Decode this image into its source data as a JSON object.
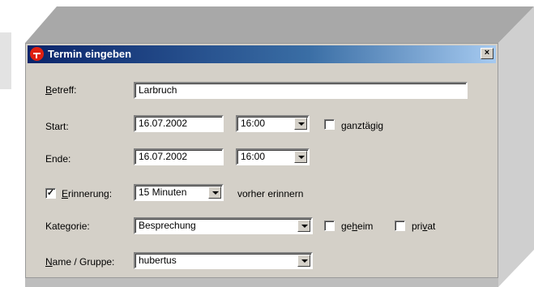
{
  "window": {
    "title": "Termin eingeben",
    "close_glyph": "×"
  },
  "form": {
    "betreff": {
      "label_u": "B",
      "label_rest": "etreff:",
      "value": "Larbruch"
    },
    "start": {
      "label": "Start:",
      "date": "16.07.2002",
      "time": "16:00",
      "allday_label": "ganztägig",
      "allday_checked": false
    },
    "ende": {
      "label": "Ende:",
      "date": "16.07.2002",
      "time": "16:00"
    },
    "erinnerung": {
      "label_u": "E",
      "label_rest": "rinnerung:",
      "checked": true,
      "value": "15 Minuten",
      "suffix": "vorher erinnern"
    },
    "kategorie": {
      "label": "Kategorie:",
      "value": "Besprechung",
      "geheim_pre": "ge",
      "geheim_u": "h",
      "geheim_post": "eim",
      "geheim_checked": false,
      "privat_pre": "pri",
      "privat_u": "v",
      "privat_post": "at",
      "privat_checked": false
    },
    "name": {
      "label_u": "N",
      "label_rest": "ame / Gruppe:",
      "value": "hubertus"
    }
  },
  "colors": {
    "dialog_bg": "#d4d0c8",
    "titlebar_start": "#0a246a",
    "titlebar_end": "#a6caf0",
    "icon_red": "#e02010"
  }
}
